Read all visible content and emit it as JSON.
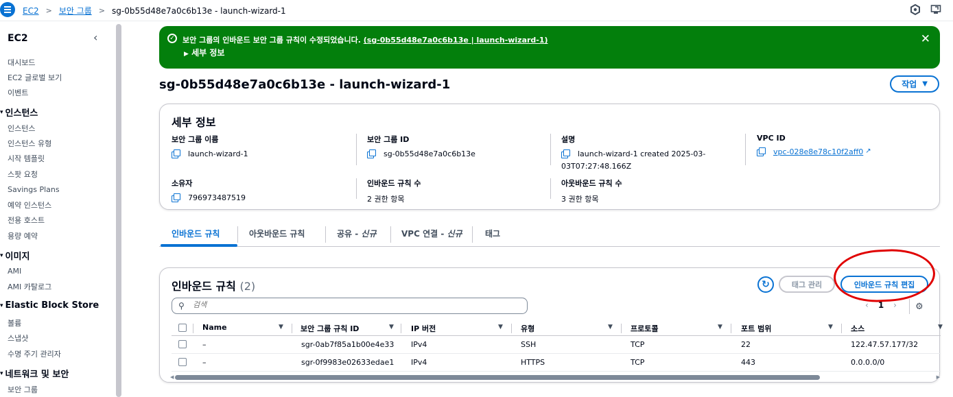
{
  "topbar": {
    "breadcrumbs": [
      "EC2",
      "보안 그룹",
      "sg-0b55d48e7a0c6b13e - launch-wizard-1"
    ]
  },
  "sidebar": {
    "title": "EC2",
    "top_items": [
      "대시보드",
      "EC2 글로벌 보기",
      "이벤트"
    ],
    "sections": [
      {
        "label": "인스턴스",
        "items": [
          "인스턴스",
          "인스턴스 유형",
          "시작 템플릿",
          "스팟 요청",
          "Savings Plans",
          "예약 인스턴스",
          "전용 호스트",
          "용량 예약"
        ]
      },
      {
        "label": "이미지",
        "items": [
          "AMI",
          "AMI 카탈로그"
        ]
      },
      {
        "label": "Elastic Block Store",
        "items": [
          "볼륨",
          "스냅샷",
          "수명 주기 관리자"
        ]
      },
      {
        "label": "네트워크 및 보안",
        "items": [
          "보안 그룹"
        ]
      }
    ]
  },
  "flash": {
    "message": "보안 그룹의 인바운드 보안 그룹 규칙이 수정되었습니다.",
    "link": "(sg-0b55d48e7a0c6b13e | launch-wizard-1)",
    "details": "세부 정보"
  },
  "page": {
    "title": "sg-0b55d48e7a0c6b13e - launch-wizard-1",
    "action_label": "작업"
  },
  "details": {
    "title": "세부 정보",
    "sg_name_label": "보안 그룹 이름",
    "sg_name": "launch-wizard-1",
    "sg_id_label": "보안 그룹 ID",
    "sg_id": "sg-0b55d48e7a0c6b13e",
    "desc_label": "설명",
    "desc_line1": "launch-wizard-1 created 2025-03-",
    "desc_line2": "03T07:27:48.166Z",
    "vpc_label": "VPC ID",
    "vpc_id": "vpc-028e8e78c10f2aff0",
    "owner_label": "소유자",
    "owner": "796973487519",
    "inbound_count_label": "인바운드 규칙 수",
    "inbound_count": "2 권한 항목",
    "outbound_count_label": "아웃바운드 규칙 수",
    "outbound_count": "3 권한 항목"
  },
  "tabs": {
    "inbound": "인바운드 규칙",
    "outbound": "아웃바운드 규칙",
    "share": "공유 - ",
    "share_new": "신규",
    "vpc": "VPC 연결 - ",
    "vpc_new": "신규",
    "tags": "태그"
  },
  "rules": {
    "title": "인바운드 규칙",
    "count": "(2)",
    "tag_button": "태그 관리",
    "edit_button": "인바운드 규칙 편집",
    "search_placeholder": "검색",
    "page": "1",
    "columns": [
      "Name",
      "보안 그룹 규칙 ID",
      "IP 버전",
      "유형",
      "프로토콜",
      "포트 범위",
      "소스"
    ],
    "rows": [
      {
        "name": "–",
        "id": "sgr-0ab7f85a1b00e4e33",
        "ip": "IPv4",
        "type": "SSH",
        "protocol": "TCP",
        "port": "22",
        "source": "122.47.57.177/32"
      },
      {
        "name": "–",
        "id": "sgr-0f9983e02633edae1",
        "ip": "IPv4",
        "type": "HTTPS",
        "protocol": "TCP",
        "port": "443",
        "source": "0.0.0.0/0"
      }
    ]
  },
  "colors": {
    "accent": "#0972d3",
    "success": "#037f0c",
    "annotation": "#e00000"
  }
}
